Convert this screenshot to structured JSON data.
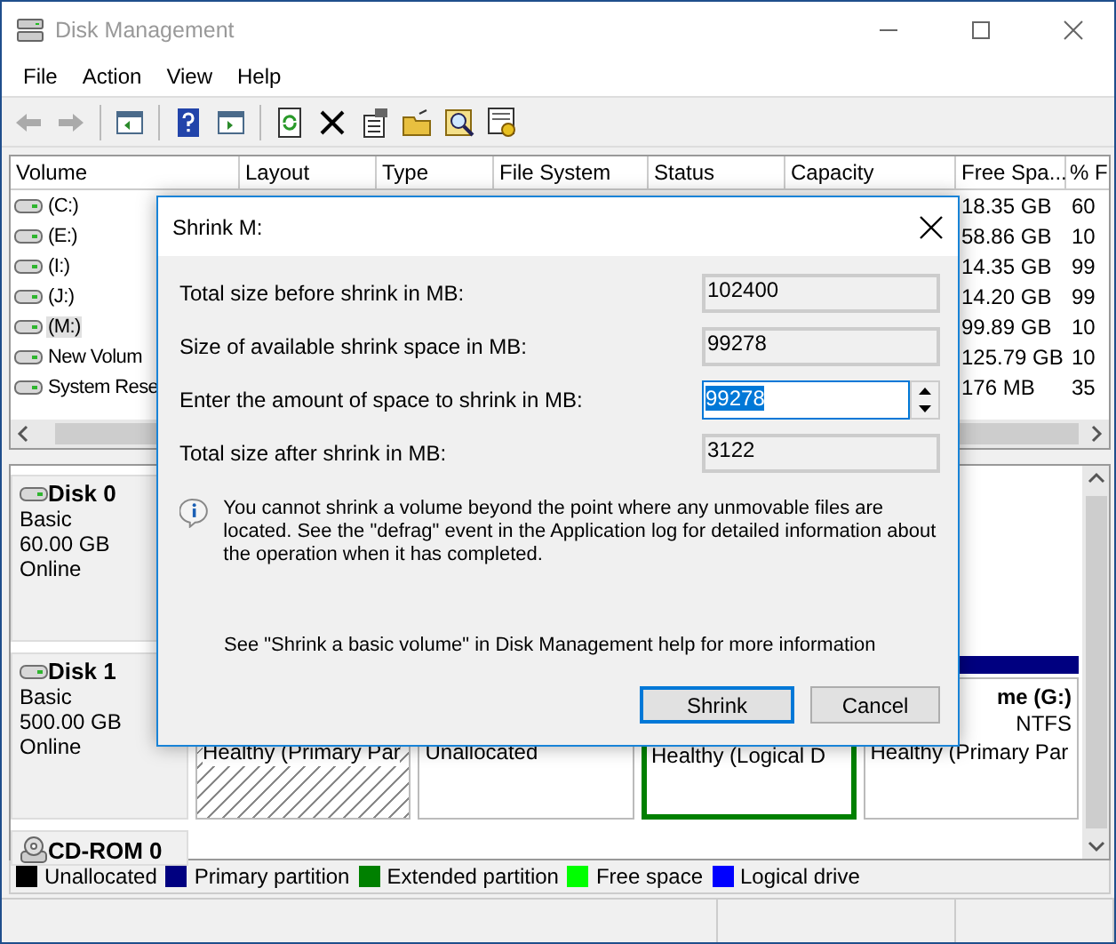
{
  "window": {
    "title": "Disk Management"
  },
  "menu": [
    "File",
    "Action",
    "View",
    "Help"
  ],
  "volume_table": {
    "columns": [
      "Volume",
      "Layout",
      "Type",
      "File System",
      "Status",
      "Capacity",
      "Free Spa...",
      "% F"
    ],
    "rows": [
      {
        "volume": "(C:)",
        "free_space": "18.35 GB",
        "percent_free": "60",
        "selected": false
      },
      {
        "volume": "(E:)",
        "free_space": "58.86 GB",
        "percent_free": "10",
        "selected": false
      },
      {
        "volume": "(I:)",
        "free_space": "14.35 GB",
        "percent_free": "99",
        "selected": false
      },
      {
        "volume": "(J:)",
        "free_space": "14.20 GB",
        "percent_free": "99",
        "selected": false
      },
      {
        "volume": "(M:)",
        "free_space": "99.89 GB",
        "percent_free": "10",
        "selected": true
      },
      {
        "volume": "New Volum",
        "free_space": "125.79 GB",
        "percent_free": "10",
        "selected": false
      },
      {
        "volume": "System Rese",
        "free_space": "176 MB",
        "percent_free": "35",
        "selected": false
      }
    ]
  },
  "disks": [
    {
      "kind": "disk",
      "name": "Disk 0",
      "details": [
        "Basic",
        "60.00 GB",
        "Online"
      ]
    },
    {
      "kind": "disk",
      "name": "Disk 1",
      "details": [
        "Basic",
        "500.00 GB",
        "Online"
      ],
      "partitions": [
        {
          "kind": "primary",
          "status": "Healthy (Primary Par",
          "selected": true
        },
        {
          "kind": "unallocated",
          "status": "Unallocated",
          "selected": false
        },
        {
          "kind": "logical",
          "status": "Healthy (Logical D",
          "selected": false
        },
        {
          "kind": "primary",
          "title": "me  (G:)",
          "file_system": "NTFS",
          "status": "Healthy (Primary Par",
          "selected": false
        }
      ]
    },
    {
      "kind": "cdrom",
      "name": "CD-ROM 0"
    }
  ],
  "legend": [
    {
      "label": "Unallocated",
      "color": "#000000"
    },
    {
      "label": "Primary partition",
      "color": "#000080"
    },
    {
      "label": "Extended partition",
      "color": "#008000"
    },
    {
      "label": "Free space",
      "color": "#00ff00"
    },
    {
      "label": "Logical drive",
      "color": "#0000ff"
    }
  ],
  "shrink_dialog": {
    "title": "Shrink M:",
    "fields": [
      {
        "kind": "readonly",
        "label": "Total size before shrink in MB:",
        "value": "102400"
      },
      {
        "kind": "readonly",
        "label": "Size of available shrink space in MB:",
        "value": "99278"
      },
      {
        "kind": "spin",
        "label": "Enter the amount of space to shrink in MB:",
        "value": "99278",
        "value_selected": true
      },
      {
        "kind": "readonly",
        "label": "Total size after shrink in MB:",
        "value": "3122"
      }
    ],
    "info": "You cannot shrink a volume beyond the point where any unmovable files are located. See the \"defrag\" event in the Application log for detailed information about the operation when it has completed.",
    "help": "See \"Shrink a basic volume\" in Disk Management help for more information",
    "buttons": [
      {
        "label": "Shrink",
        "default": true
      },
      {
        "label": "Cancel",
        "default": false
      }
    ]
  }
}
